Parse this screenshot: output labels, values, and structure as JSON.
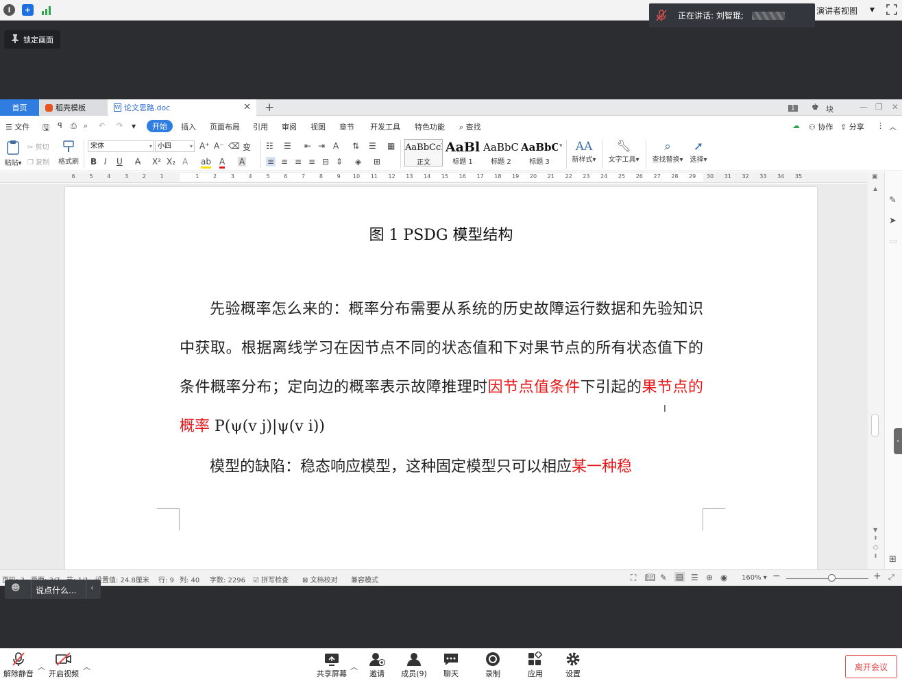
{
  "meeting": {
    "speaking_label": "正在讲话: 刘智琨;",
    "presenter_view_label": "演讲者视图",
    "lock_screen_label": "锁定画面",
    "chat_placeholder": "说点什么...",
    "toolbar": {
      "mute_label": "解除静音",
      "video_label": "开启视频",
      "share_label": "共享屏幕",
      "invite_label": "邀请",
      "members_label": "成员(9)",
      "chat_label": "聊天",
      "record_label": "录制",
      "apps_label": "应用",
      "settings_label": "设置",
      "leave_label": "离开会议"
    }
  },
  "wps": {
    "tabs": {
      "home": "首页",
      "template": "稻壳模板",
      "doc": "论文思路.doc"
    },
    "title_right": {
      "page_badge": "1",
      "user_label": "块"
    },
    "menu": {
      "file": "文件",
      "start": "开始",
      "insert": "插入",
      "layout": "页面布局",
      "reference": "引用",
      "review": "审阅",
      "view": "视图",
      "section": "章节",
      "dev": "开发工具",
      "special": "特色功能",
      "search": "查找",
      "collab": "协作",
      "share": "分享"
    },
    "ribbon": {
      "paste": "粘贴",
      "cut": "剪切",
      "copy": "复制",
      "format_painter": "格式刷",
      "font_name": "宋体",
      "font_size": "小四",
      "styles": [
        {
          "sample": "AaBbCcDd",
          "label": "正文"
        },
        {
          "sample": "AaBl",
          "label": "标题 1"
        },
        {
          "sample": "AaBbC",
          "label": "标题 2"
        },
        {
          "sample": "AaBbC",
          "label": "标题 3"
        }
      ],
      "new_style": "新样式",
      "text_tool": "文字工具",
      "find_replace": "查找替换",
      "select": "选择"
    },
    "ruler_ticks": [
      "6",
      "5",
      "4",
      "3",
      "2",
      "1",
      "",
      "1",
      "2",
      "3",
      "4",
      "5",
      "6",
      "7",
      "8",
      "9",
      "10",
      "11",
      "12",
      "13",
      "14",
      "15",
      "16",
      "17",
      "18",
      "19",
      "20",
      "21",
      "22",
      "23",
      "24",
      "25",
      "26",
      "27",
      "28",
      "29",
      "30",
      "31",
      "32",
      "33",
      "34",
      "35"
    ],
    "document": {
      "caption": "图 1 PSDG 模型结构",
      "para1_a": "先验概率怎么来的：概率分布需要从系统的历史故障运行数据和先验知识中获取。根据离线学习在因节点不同的状态值和下对果节点的所有状态值下的条件概率分布；定向边的概率表示故障推理时",
      "para1_red1": "因节点值条件",
      "para1_b": "下引起的",
      "para1_red2": "果节点的概率",
      "para1_c": " P(ψ(v j)|ψ(v i))",
      "para2_a": "模型的缺陷：稳态响应模型，这种固定模型只可以相应",
      "para2_red": "某一种稳"
    },
    "status": {
      "page_num": "页码: 3",
      "pages": "页面: 3/7",
      "section": "节: 1/1",
      "position": "设置值: 24.8厘米",
      "row": "行: 9",
      "col": "列: 40",
      "word_count": "字数: 2296",
      "spell_check": "拼写检查",
      "doc_check": "文档校对",
      "compat": "兼容模式",
      "zoom": "160%"
    }
  },
  "colors": {
    "accent": "#2f7de1",
    "red_text": "#e8171a",
    "leave": "#e24a4a"
  }
}
